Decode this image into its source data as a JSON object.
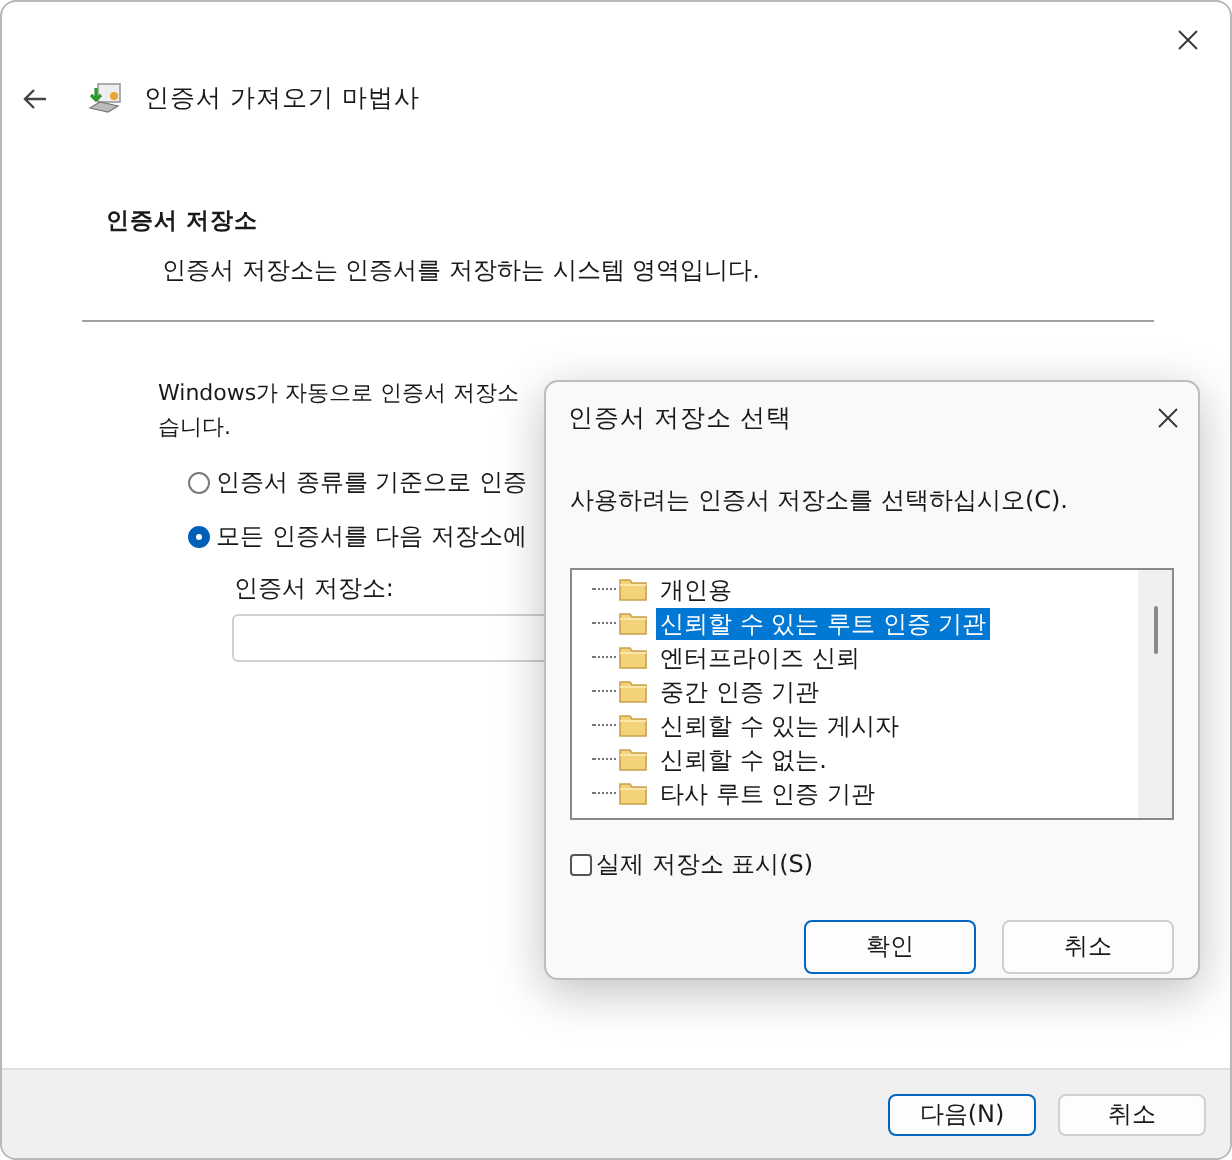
{
  "wizard": {
    "title": "인증서 가져오기 마법사",
    "section_title": "인증서 저장소",
    "section_subtitle": "인증서 저장소는 인증서를 저장하는 시스템 영역입니다.",
    "intro_lines": [
      "Windows가 자동으로 인증서 저장소",
      "습니다."
    ],
    "options": [
      {
        "label": "인증서 종류를 기준으로 인증",
        "selected": false
      },
      {
        "label": "모든 인증서를 다음 저장소에",
        "selected": true
      }
    ],
    "store_label": "인증서 저장소:",
    "buttons": [
      {
        "label": "다음(N)",
        "primary": true
      },
      {
        "label": "취소",
        "primary": false
      }
    ]
  },
  "dialog": {
    "title": "인증서 저장소 선택",
    "prompt": "사용하려는 인증서 저장소를 선택하십시오(C).",
    "stores": [
      {
        "label": "개인용",
        "selected": false
      },
      {
        "label": "신뢰할 수 있는 루트 인증 기관",
        "selected": true
      },
      {
        "label": "엔터프라이즈 신뢰",
        "selected": false
      },
      {
        "label": "중간 인증 기관",
        "selected": false
      },
      {
        "label": "신뢰할 수 있는 게시자",
        "selected": false
      },
      {
        "label": "신뢰할 수 없는.",
        "selected": false
      },
      {
        "label": "타사 루트 인증 기관",
        "selected": false
      }
    ],
    "show_physical": {
      "label": "실제 저장소 표시(S)",
      "checked": false
    },
    "buttons": [
      {
        "label": "확인",
        "primary": true
      },
      {
        "label": "취소",
        "primary": false
      }
    ]
  }
}
